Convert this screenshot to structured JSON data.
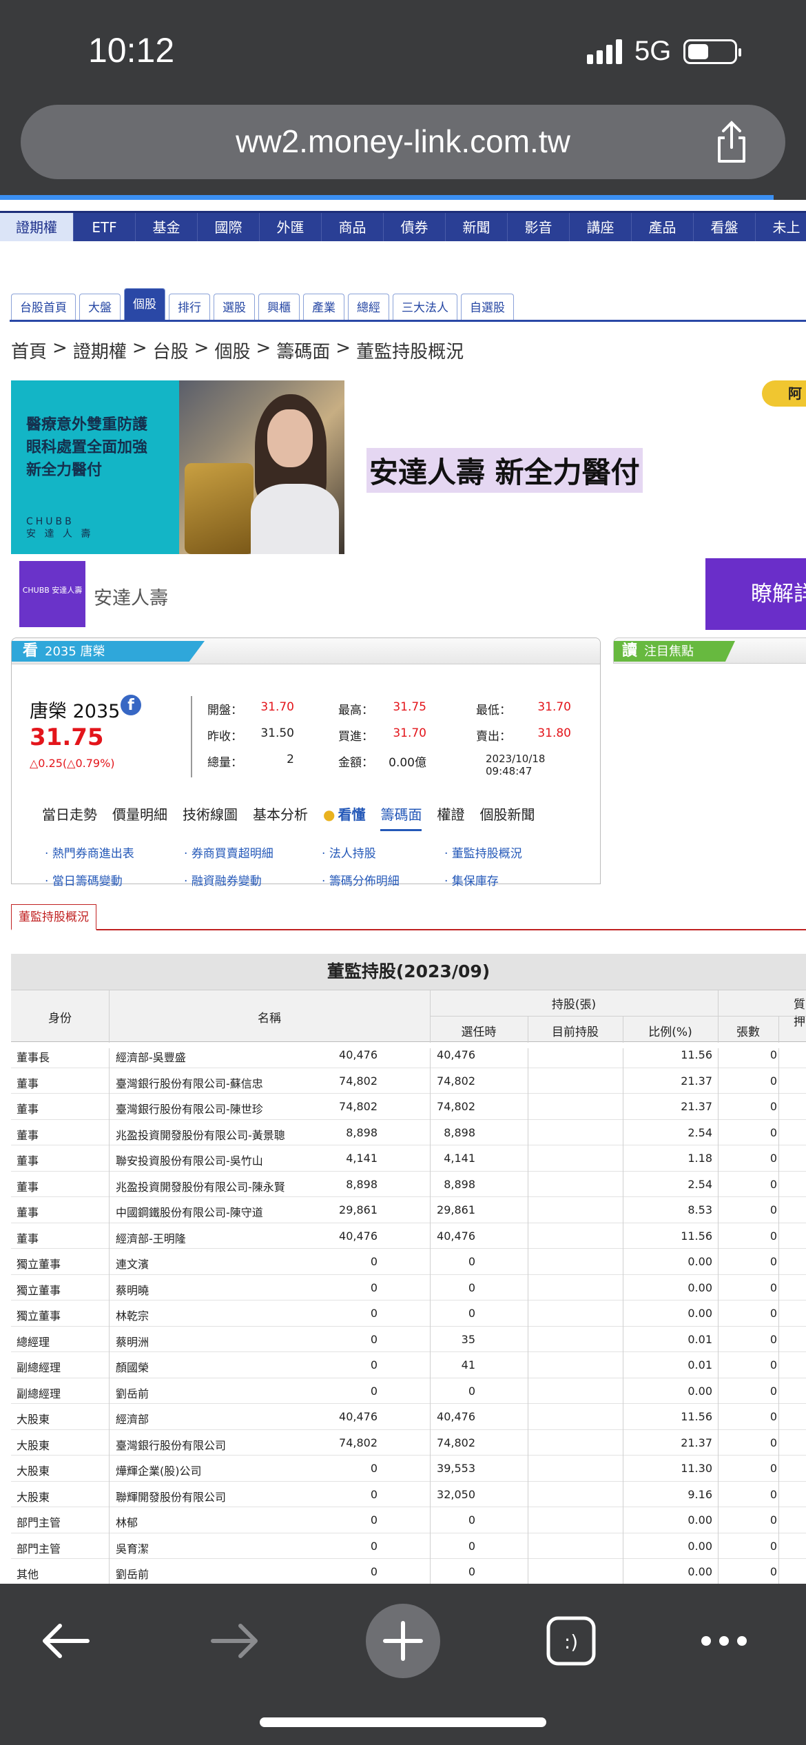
{
  "status": {
    "time": "10:12",
    "network": "5G",
    "battery_level": 0.45
  },
  "browser": {
    "url": "ww2.money-link.com.tw",
    "share_icon": "share-icon",
    "load_progress": 0.96
  },
  "main_nav": [
    "證期權",
    "ETF",
    "基金",
    "國際",
    "外匯",
    "商品",
    "債券",
    "新聞",
    "影音",
    "講座",
    "產品",
    "看盤",
    "未上"
  ],
  "sub_tabs": [
    "台股首頁",
    "大盤",
    "個股",
    "排行",
    "選股",
    "興櫃",
    "產業",
    "總經",
    "三大法人",
    "自選股"
  ],
  "breadcrumb": [
    "首頁",
    ">",
    "證期權",
    ">",
    "台股",
    ">",
    "個股",
    ">",
    "籌碼面",
    ">",
    "董監持股概況"
  ],
  "ad": {
    "left_lines": [
      "醫療意外雙重防護",
      "眼科處置全面加強",
      "新全力醫付"
    ],
    "chubb_en": "CHUBB",
    "chubb_zh": "安 達 人 壽",
    "headline": "安達人壽 新全力醫付",
    "avatar_text": "阿",
    "logo_text": "CHUBB 安達人壽",
    "brand": "安達人壽",
    "cta": "瞭解詳"
  },
  "quote": {
    "panel_icon": "看",
    "panel_label": "2035 唐榮",
    "name": "唐榮 2035",
    "fb_icon": "f",
    "price": "31.75",
    "change": "△0.25(△0.79%)",
    "rows": [
      [
        {
          "l": "開盤：",
          "v": "31.70",
          "red": true
        },
        {
          "l": "最高：",
          "v": "31.75",
          "red": true
        },
        {
          "l": "最低：",
          "v": "31.70",
          "red": true
        }
      ],
      [
        {
          "l": "昨收：",
          "v": "31.50",
          "red": false
        },
        {
          "l": "買進：",
          "v": "31.70",
          "red": true
        },
        {
          "l": "賣出：",
          "v": "31.80",
          "red": true
        }
      ],
      [
        {
          "l": "總量：",
          "v": "2",
          "red": false
        },
        {
          "l": "金額：",
          "v": "0.00億",
          "red": false
        },
        {
          "l": "",
          "v": "2023/10/18 09:48:47",
          "red": false
        }
      ]
    ],
    "subnav": [
      "當日走勢",
      "價量明細",
      "技術線圖",
      "基本分析",
      "看懂",
      "籌碼面",
      "權證",
      "個股新聞"
    ],
    "links": [
      "熱門券商進出表",
      "券商買賣超明細",
      "法人持股",
      "董監持股概況",
      "當日籌碼變動",
      "融資融券變動",
      "籌碼分佈明細",
      "集保庫存"
    ]
  },
  "focus": {
    "icon": "讀",
    "label": "注目焦點"
  },
  "section_tab": "董監持股概況",
  "table": {
    "title": "董監持股(2023/09)",
    "headers": {
      "role": "身份",
      "name": "名稱",
      "holding_group": "持股(張)",
      "elected": "選任時",
      "current": "目前持股",
      "ratio": "比例(%)",
      "pledge_group": "質押",
      "pledge_count": "張數"
    },
    "rows": [
      [
        "董事長",
        "經濟部-吳豐盛",
        "40,476",
        "40,476",
        "11.56",
        "0"
      ],
      [
        "董事",
        "臺灣銀行股份有限公司-蘇信忠",
        "74,802",
        "74,802",
        "21.37",
        "0"
      ],
      [
        "董事",
        "臺灣銀行股份有限公司-陳世珍",
        "74,802",
        "74,802",
        "21.37",
        "0"
      ],
      [
        "董事",
        "兆盈投資開發股份有限公司-黃景聰",
        "8,898",
        "8,898",
        "2.54",
        "0"
      ],
      [
        "董事",
        "聯安投資股份有限公司-吳竹山",
        "4,141",
        "4,141",
        "1.18",
        "0"
      ],
      [
        "董事",
        "兆盈投資開發股份有限公司-陳永賢",
        "8,898",
        "8,898",
        "2.54",
        "0"
      ],
      [
        "董事",
        "中國鋼鐵股份有限公司-陳守道",
        "29,861",
        "29,861",
        "8.53",
        "0"
      ],
      [
        "董事",
        "經濟部-王明隆",
        "40,476",
        "40,476",
        "11.56",
        "0"
      ],
      [
        "獨立董事",
        "連文濱",
        "0",
        "0",
        "0.00",
        "0"
      ],
      [
        "獨立董事",
        "蔡明曉",
        "0",
        "0",
        "0.00",
        "0"
      ],
      [
        "獨立董事",
        "林乾宗",
        "0",
        "0",
        "0.00",
        "0"
      ],
      [
        "總經理",
        "蔡明洲",
        "0",
        "35",
        "0.01",
        "0"
      ],
      [
        "副總經理",
        "顏國榮",
        "0",
        "41",
        "0.01",
        "0"
      ],
      [
        "副總經理",
        "劉岳前",
        "0",
        "0",
        "0.00",
        "0"
      ],
      [
        "大股東",
        "經濟部",
        "40,476",
        "40,476",
        "11.56",
        "0"
      ],
      [
        "大股東",
        "臺灣銀行股份有限公司",
        "74,802",
        "74,802",
        "21.37",
        "0"
      ],
      [
        "大股東",
        "燁輝企業(股)公司",
        "0",
        "39,553",
        "11.30",
        "0"
      ],
      [
        "大股東",
        "聯輝開發股份有限公司",
        "0",
        "32,050",
        "9.16",
        "0"
      ],
      [
        "部門主管",
        "林郁",
        "0",
        "0",
        "0.00",
        "0"
      ],
      [
        "部門主管",
        "吳育潔",
        "0",
        "0",
        "0.00",
        "0"
      ],
      [
        "其他",
        "劉岳前",
        "0",
        "0",
        "0.00",
        "0"
      ]
    ]
  },
  "toolbar": {
    "back": "back-icon",
    "forward": "forward-icon",
    "new_tab": "plus-icon",
    "tabs": "tabs-icon",
    "tabs_label": ":)",
    "more": "more-icon"
  }
}
